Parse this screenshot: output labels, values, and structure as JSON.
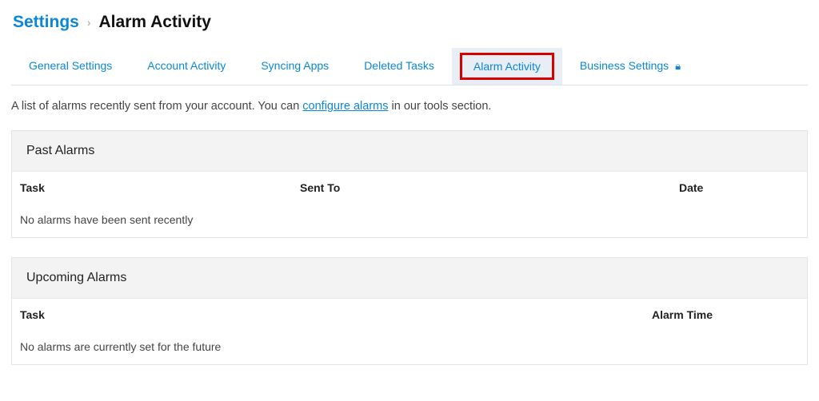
{
  "breadcrumb": {
    "root": "Settings",
    "current": "Alarm Activity"
  },
  "tabs": {
    "general": "General Settings",
    "account": "Account Activity",
    "syncing": "Syncing Apps",
    "deleted": "Deleted Tasks",
    "alarm": "Alarm Activity",
    "business": "Business Settings"
  },
  "description": {
    "prefix": "A list of alarms recently sent from your account. You can ",
    "link": "configure alarms",
    "suffix": " in our tools section."
  },
  "past": {
    "title": "Past Alarms",
    "col_task": "Task",
    "col_sent_to": "Sent To",
    "col_date": "Date",
    "empty": "No alarms have been sent recently"
  },
  "upcoming": {
    "title": "Upcoming Alarms",
    "col_task": "Task",
    "col_alarm_time": "Alarm Time",
    "empty": "No alarms are currently set for the future"
  }
}
